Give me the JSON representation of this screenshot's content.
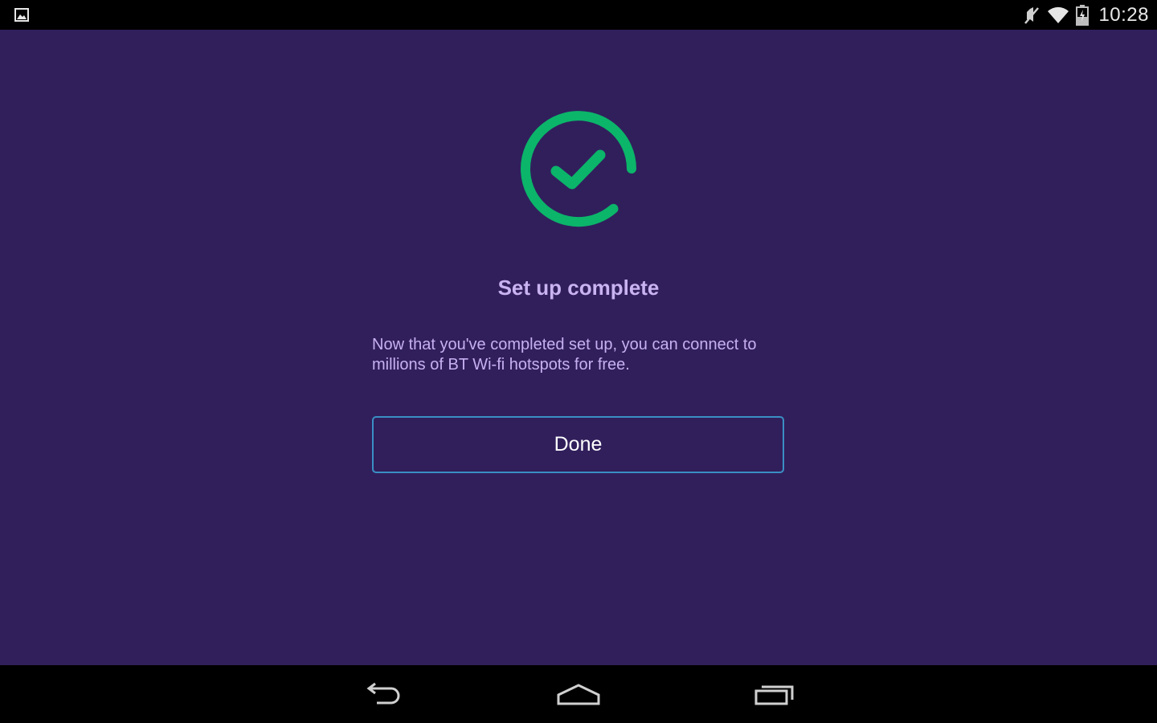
{
  "status_bar": {
    "time": "10:28",
    "icons": [
      "image-notification-icon",
      "mute-icon",
      "wifi-icon",
      "battery-charging-icon"
    ]
  },
  "main": {
    "icon": "success-check-circle-icon",
    "title": "Set up complete",
    "message": "Now that you've completed set up, you can connect to millions of BT Wi-fi hotspots for free.",
    "done_button_label": "Done"
  },
  "nav_bar": {
    "buttons": [
      "back-icon",
      "home-icon",
      "recents-icon"
    ]
  },
  "colors": {
    "background": "#311f5c",
    "accent_green": "#0bb56a",
    "title_text": "#c9b3f0",
    "button_border": "#3a8fc4"
  }
}
